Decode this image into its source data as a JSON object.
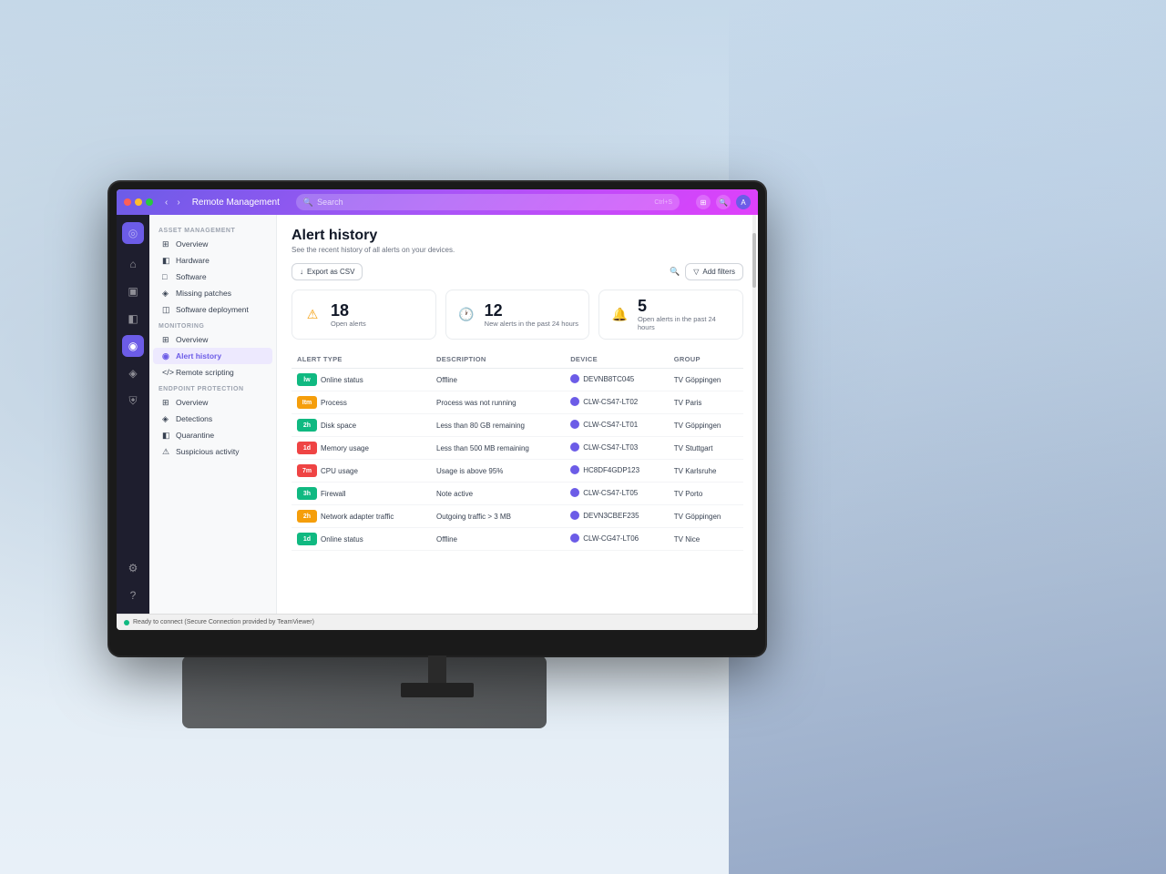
{
  "app": {
    "title": "Remote Management",
    "search_placeholder": "Search",
    "search_shortcut": "Ctrl+S"
  },
  "sidebar": {
    "asset_management": {
      "section_title": "ASSET MANAGEMENT",
      "items": [
        {
          "id": "overview",
          "label": "Overview",
          "icon": "⊞"
        },
        {
          "id": "hardware",
          "label": "Hardware",
          "icon": "◧"
        },
        {
          "id": "software",
          "label": "Software",
          "icon": "□"
        },
        {
          "id": "missing-patches",
          "label": "Missing patches",
          "icon": "◈"
        },
        {
          "id": "software-deployment",
          "label": "Software deployment",
          "icon": "◫"
        }
      ]
    },
    "monitoring": {
      "section_title": "MONITORING",
      "items": [
        {
          "id": "mon-overview",
          "label": "Overview",
          "icon": "⊞"
        },
        {
          "id": "alert-history",
          "label": "Alert history",
          "icon": "◉",
          "active": true
        },
        {
          "id": "remote-scripting",
          "label": "Remote scripting",
          "icon": "</>"
        }
      ]
    },
    "endpoint_protection": {
      "section_title": "ENDPOINT PROTECTION",
      "items": [
        {
          "id": "ep-overview",
          "label": "Overview",
          "icon": "⊞"
        },
        {
          "id": "detections",
          "label": "Detections",
          "icon": "◈"
        },
        {
          "id": "quarantine",
          "label": "Quarantine",
          "icon": "◧"
        },
        {
          "id": "suspicious-activity",
          "label": "Suspicious activity",
          "icon": "⚠"
        }
      ]
    }
  },
  "page": {
    "title": "Alert history",
    "subtitle": "See the recent history of all alerts on your devices.",
    "export_label": "Export as CSV",
    "filter_label": "Add filters"
  },
  "stats": [
    {
      "id": "open-alerts",
      "number": "18",
      "label": "Open alerts",
      "icon": "⚠",
      "icon_color": "#f59e0b"
    },
    {
      "id": "new-alerts-24h",
      "number": "12",
      "label": "New alerts in the past 24 hours",
      "icon": "🕐",
      "icon_color": "#6c5ce7"
    },
    {
      "id": "open-alerts-24h",
      "number": "5",
      "label": "Open alerts in the past 24 hours",
      "icon": "🔔",
      "icon_color": "#10b981"
    }
  ],
  "table": {
    "columns": [
      "Alert type",
      "Description",
      "Device",
      "Group"
    ],
    "rows": [
      {
        "severity": "low",
        "severity_label": "lw",
        "type": "Online status",
        "description": "Offline",
        "device": "DEVNB8TC045",
        "group": "TV Göppingen"
      },
      {
        "severity": "med",
        "severity_label": "Itm",
        "type": "Process",
        "description": "Process was not running",
        "device": "CLW-CS47-LT02",
        "group": "TV Paris"
      },
      {
        "severity": "low",
        "severity_label": "2h",
        "type": "Disk space",
        "description": "Less than 80 GB remaining",
        "device": "CLW-CS47-LT01",
        "group": "TV Göppingen"
      },
      {
        "severity": "high",
        "severity_label": "1d",
        "type": "Memory usage",
        "description": "Less than 500 MB remaining",
        "device": "CLW-CS47-LT03",
        "group": "TV Stuttgart"
      },
      {
        "severity": "high",
        "severity_label": "7m",
        "type": "CPU usage",
        "description": "Usage is above 95%",
        "device": "HC8DF4GDP123",
        "group": "TV Karlsruhe"
      },
      {
        "severity": "low",
        "severity_label": "3h",
        "type": "Firewall",
        "description": "Note active",
        "device": "CLW-CS47-LT05",
        "group": "TV Porto"
      },
      {
        "severity": "med",
        "severity_label": "2h",
        "type": "Network adapter traffic",
        "description": "Outgoing traffic > 3 MB",
        "device": "DEVN3CBEF235",
        "group": "TV Göppingen"
      },
      {
        "severity": "low",
        "severity_label": "1d",
        "type": "Online status",
        "description": "Offline",
        "device": "CLW-CG47-LT06",
        "group": "TV Nice"
      }
    ]
  },
  "status_bar": {
    "text": "Ready to connect (Secure Connection provided by TeamViewer)"
  }
}
